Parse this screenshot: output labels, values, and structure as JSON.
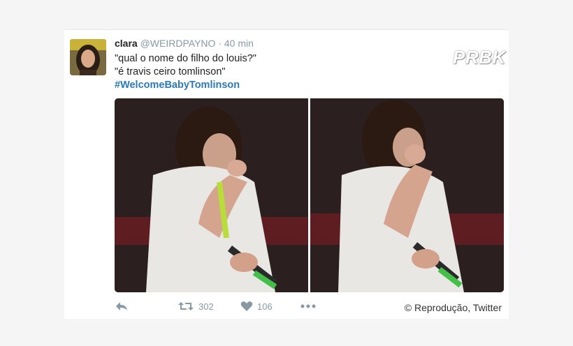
{
  "tweet": {
    "name": "clara",
    "handle": "@WEIRDPAYNO",
    "separator": "·",
    "time": "40 min",
    "lines": [
      "\"qual o nome do filho do louis?\"",
      "\"é travis ceiro tomlinson\""
    ],
    "hashtag": "#WelcomeBabyTomlinson"
  },
  "watermark": "PRBK",
  "media": {
    "description_icons": [
      "photo-left",
      "photo-right"
    ]
  },
  "actions": {
    "reply_icon": "reply-icon",
    "retweet_icon": "retweet-icon",
    "retweet_count": "302",
    "like_icon": "heart-icon",
    "like_count": "106",
    "more_icon": "more-icon"
  },
  "credit": "© Reprodução, Twitter",
  "colors": {
    "hashtag": "#2b7bb9",
    "meta": "#8899a6",
    "background": "#f5f5f5"
  }
}
